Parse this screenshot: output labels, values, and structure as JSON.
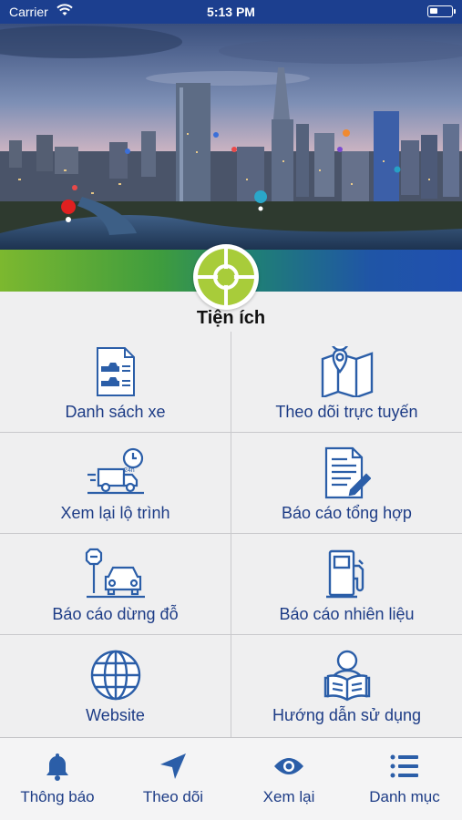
{
  "status_bar": {
    "carrier": "Carrier",
    "time": "5:13 PM"
  },
  "section": {
    "title": "Tiện ích"
  },
  "menu_items": [
    {
      "label": "Danh sách xe",
      "icon": "vehicle-list-icon"
    },
    {
      "label": "Theo dõi trực tuyến",
      "icon": "map-pin-icon"
    },
    {
      "label": "Xem lại lộ trình",
      "icon": "truck-24h-icon"
    },
    {
      "label": "Báo cáo tổng hợp",
      "icon": "report-document-icon"
    },
    {
      "label": "Báo cáo dừng đỗ",
      "icon": "parking-car-icon"
    },
    {
      "label": "Báo cáo nhiên liệu",
      "icon": "fuel-pump-icon"
    },
    {
      "label": "Website",
      "icon": "globe-icon"
    },
    {
      "label": "Hướng dẫn sử dụng",
      "icon": "user-guide-icon"
    }
  ],
  "tabs": [
    {
      "label": "Thông báo",
      "icon": "bell-icon"
    },
    {
      "label": "Theo dõi",
      "icon": "navigation-arrow-icon"
    },
    {
      "label": "Xem lại",
      "icon": "eye-icon"
    },
    {
      "label": "Danh mục",
      "icon": "list-icon"
    }
  ],
  "colors": {
    "primary": "#1d3c86",
    "icon_blue": "#2b5ea8",
    "status_bar": "#1c3f8f",
    "logo_green": "#a8cc3a"
  }
}
